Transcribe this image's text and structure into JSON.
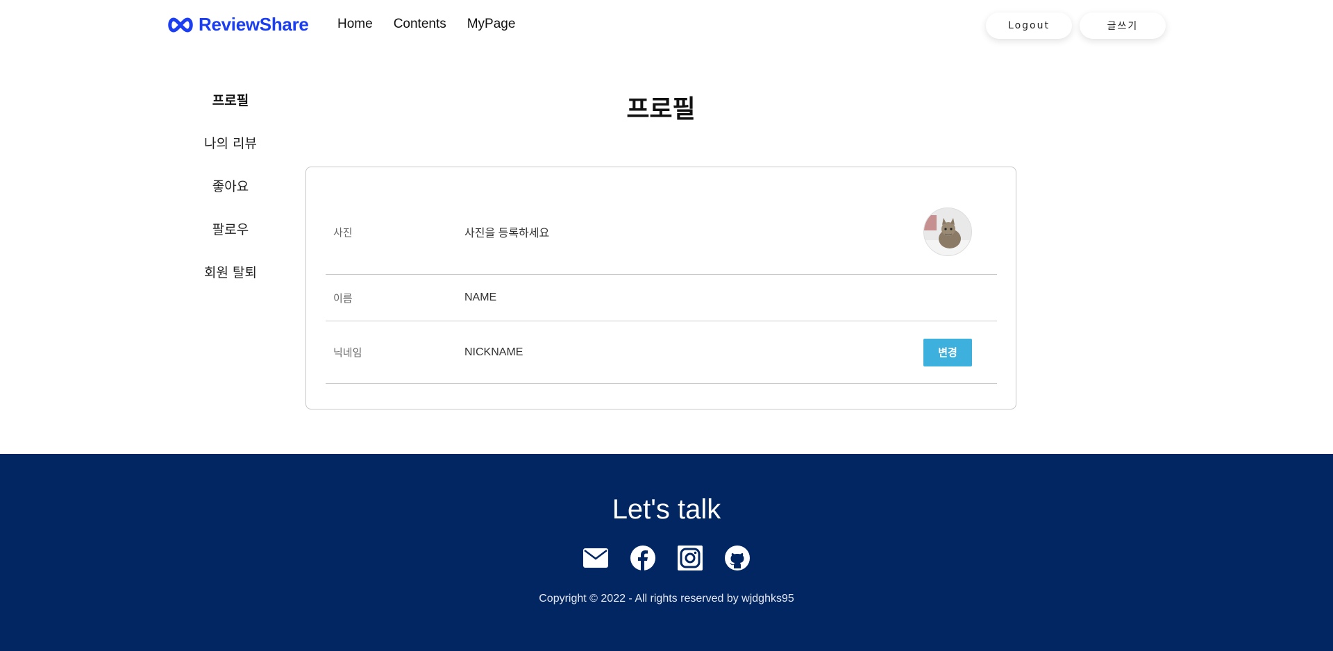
{
  "header": {
    "logo_text": "ReviewShare",
    "nav": [
      "Home",
      "Contents",
      "MyPage"
    ],
    "logout_label": "Logout",
    "write_label": "글쓰기"
  },
  "sidebar": {
    "items": [
      {
        "label": "프로필",
        "active": true
      },
      {
        "label": "나의 리뷰",
        "active": false
      },
      {
        "label": "좋아요",
        "active": false
      },
      {
        "label": "팔로우",
        "active": false
      },
      {
        "label": "회원 탈퇴",
        "active": false
      }
    ]
  },
  "main": {
    "title": "프로필",
    "rows": {
      "photo": {
        "label": "사진",
        "value": "사진을 등록하세요"
      },
      "name": {
        "label": "이름",
        "value": "NAME"
      },
      "nickname": {
        "label": "닉네임",
        "value": "NICKNAME",
        "button": "변경"
      }
    }
  },
  "footer": {
    "heading": "Let's talk",
    "icons": [
      "mail-icon",
      "facebook-icon",
      "instagram-icon",
      "github-icon"
    ],
    "copyright": "Copyright © 2022 - All rights reserved by wjdghks95"
  },
  "colors": {
    "brand": "#1a3ef0",
    "footer_bg": "#012662",
    "button": "#3db0de"
  }
}
